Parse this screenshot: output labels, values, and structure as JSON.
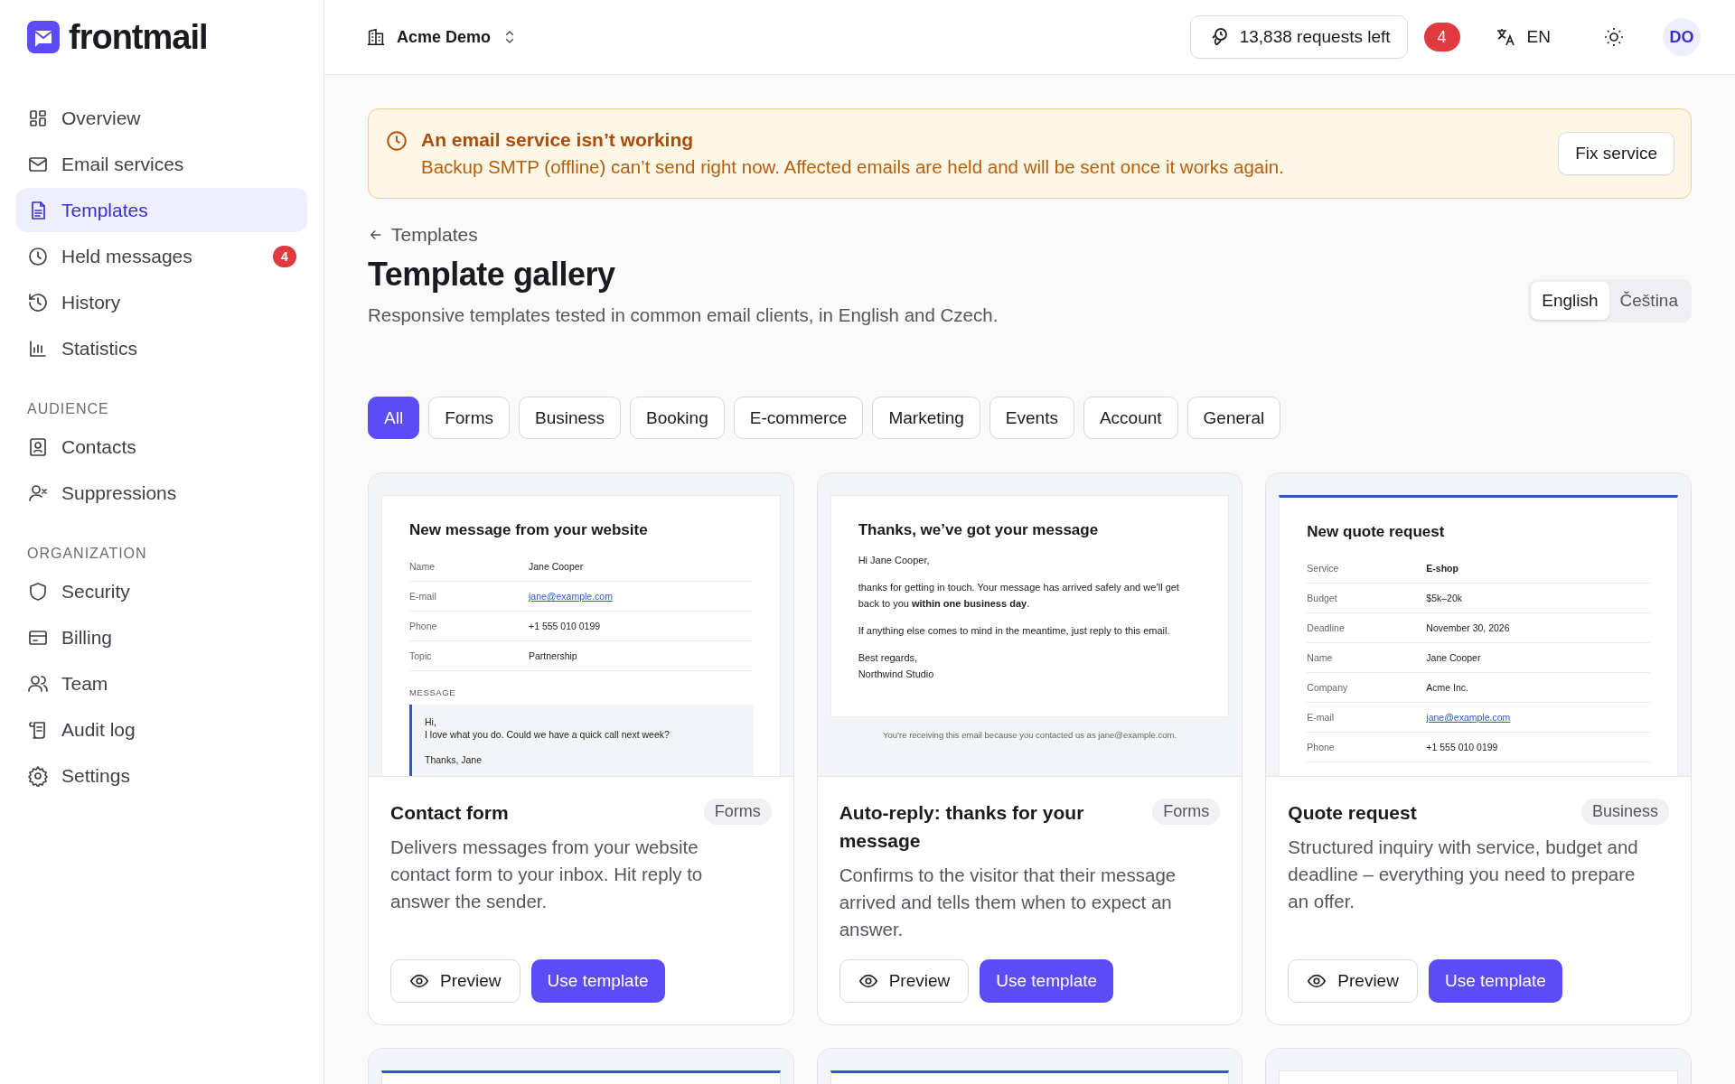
{
  "sidebar": {
    "logo": "frontmail",
    "sections": [
      {
        "items": [
          {
            "label": "Overview",
            "selected": false
          },
          {
            "label": "Email services",
            "selected": false
          },
          {
            "label": "Templates",
            "selected": true
          },
          {
            "label": "Held messages",
            "selected": false,
            "badge": "4"
          },
          {
            "label": "History",
            "selected": false
          },
          {
            "label": "Statistics",
            "selected": false
          }
        ]
      },
      {
        "heading": "AUDIENCE",
        "items": [
          {
            "label": "Contacts",
            "selected": false
          },
          {
            "label": "Suppressions",
            "selected": false
          }
        ]
      },
      {
        "heading": "ORGANIZATION",
        "items": [
          {
            "label": "Security",
            "selected": false
          },
          {
            "label": "Billing",
            "selected": false
          },
          {
            "label": "Team",
            "selected": false
          },
          {
            "label": "Audit log",
            "selected": false
          },
          {
            "label": "Settings",
            "selected": false
          }
        ]
      }
    ]
  },
  "topbar": {
    "organization": "Acme Demo",
    "requests": "13,838 requests left",
    "notifications": "4",
    "language": "EN",
    "avatar": "DO"
  },
  "alert": {
    "title": "An email service isn’t working",
    "message": "Backup SMTP (offline) can’t send right now. Affected emails are held and will be sent once it works again.",
    "button": "Fix service"
  },
  "breadcrumb": "Templates",
  "title": "Template gallery",
  "subtitle": "Responsive templates tested in common email clients, in English and Czech.",
  "languages": [
    {
      "label": "English",
      "selected": true
    },
    {
      "label": "Čeština",
      "selected": false
    }
  ],
  "filters": [
    {
      "label": "All",
      "selected": true
    },
    {
      "label": "Forms",
      "selected": false
    },
    {
      "label": "Business",
      "selected": false
    },
    {
      "label": "Booking",
      "selected": false
    },
    {
      "label": "E-commerce",
      "selected": false
    },
    {
      "label": "Marketing",
      "selected": false
    },
    {
      "label": "Events",
      "selected": false
    },
    {
      "label": "Account",
      "selected": false
    },
    {
      "label": "General",
      "selected": false
    }
  ],
  "cards": [
    {
      "preview": {
        "kind": "table",
        "accent": false,
        "heading": "New message from your website",
        "rows": [
          {
            "label": "Name",
            "value": "Jane Cooper",
            "kind": "text"
          },
          {
            "label": "E-mail",
            "value": "jane@example.com",
            "kind": "link"
          },
          {
            "label": "Phone",
            "value": "+1 555 010 0199",
            "kind": "text"
          },
          {
            "label": "Topic",
            "value": "Partnership",
            "kind": "text"
          }
        ],
        "message_label": "MESSAGE",
        "message_lines": [
          "Hi,\nI love what you do. Could we have a quick call next week?",
          "Thanks, Jane"
        ]
      },
      "title": "Contact form",
      "tag": "Forms",
      "description": "Delivers messages from your website contact form to your inbox. Hit reply to answer the sender.",
      "buttons": {
        "preview": "Preview",
        "use": "Use template"
      }
    },
    {
      "preview": {
        "kind": "letter",
        "accent": false,
        "heading": "Thanks, we’ve got your message",
        "paragraphs": [
          "Hi Jane Cooper,",
          "thanks for getting in touch. Your message has arrived safely and we’ll get back to you **within one business day**.",
          "If anything else comes to mind in the meantime, just reply to this email.",
          "Best regards,\nNorthwind Studio"
        ],
        "footer": "You’re receiving this email because you contacted us as jane@example.com."
      },
      "title": "Auto-reply: thanks for your message",
      "tag": "Forms",
      "description": "Confirms to the visitor that their message arrived and tells them when to expect an answer.",
      "buttons": {
        "preview": "Preview",
        "use": "Use template"
      }
    },
    {
      "preview": {
        "kind": "table",
        "accent": true,
        "heading": "New quote request",
        "rows": [
          {
            "label": "Service",
            "value": "E-shop",
            "kind": "bold"
          },
          {
            "label": "Budget",
            "value": "$5k–20k",
            "kind": "text"
          },
          {
            "label": "Deadline",
            "value": "November 30, 2026",
            "kind": "text"
          },
          {
            "label": "Name",
            "value": "Jane Cooper",
            "kind": "text"
          },
          {
            "label": "Company",
            "value": "Acme Inc.",
            "kind": "text"
          },
          {
            "label": "E-mail",
            "value": "jane@example.com",
            "kind": "link"
          },
          {
            "label": "Phone",
            "value": "+1 555 010 0199",
            "kind": "text"
          }
        ]
      },
      "title": "Quote request",
      "tag": "Business",
      "description": "Structured inquiry with service, budget and deadline – everything you need to prepare an offer.",
      "buttons": {
        "preview": "Preview",
        "use": "Use template"
      }
    }
  ],
  "more_cards": [
    {
      "accent": true
    },
    {
      "accent": true
    },
    {
      "accent": false
    }
  ]
}
